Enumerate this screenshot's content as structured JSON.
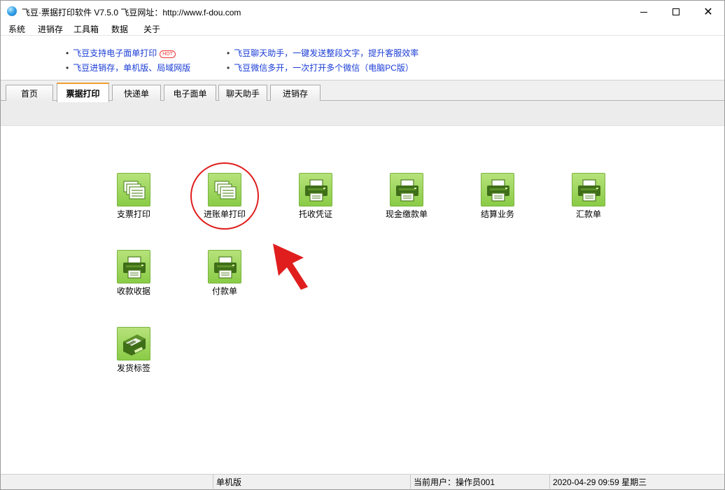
{
  "window": {
    "title": "飞豆·票据打印软件 V7.5.0  飞豆网址：http://www.f-dou.com",
    "close_glyph": "✕"
  },
  "menu": [
    "系统",
    "进销存",
    "工具箱",
    "数据",
    "关于"
  ],
  "ads": {
    "left": [
      {
        "text": "飞豆支持电子面单打印",
        "badge": "HOT"
      },
      {
        "text": "飞豆进销存，单机版、局域网版"
      }
    ],
    "right": [
      {
        "text": "飞豆聊天助手，一键发送整段文字，提升客服效率"
      },
      {
        "text": "飞豆微信多开，一次打开多个微信（电脑PC版）"
      }
    ],
    "bullet": "•"
  },
  "tabs": [
    "首页",
    "票据打印",
    "快递单",
    "电子面单",
    "聊天助手",
    "进销存"
  ],
  "active_tab": "票据打印",
  "tiles": [
    {
      "label": "支票打印",
      "icon": "documents-icon"
    },
    {
      "label": "进账单打印",
      "icon": "documents-icon"
    },
    {
      "label": "托收凭证",
      "icon": "printer-icon"
    },
    {
      "label": "现金缴款单",
      "icon": "printer-icon"
    },
    {
      "label": "结算业务",
      "icon": "printer-icon"
    },
    {
      "label": "汇款单",
      "icon": "printer-icon"
    },
    {
      "label": "收款收据",
      "icon": "printer-icon"
    },
    {
      "label": "付款单",
      "icon": "printer-icon"
    },
    {
      "label": "发货标签",
      "icon": "label-printer-icon"
    }
  ],
  "status": {
    "edition": "单机版",
    "user": "当前用户：操作员001",
    "datetime": "2020-04-29 09:59 星期三"
  },
  "colors": {
    "tile_green": "#8acb46",
    "link_blue": "#1a3cd6",
    "annotation_red": "#e01e1e",
    "active_tab_accent": "#f0a030"
  }
}
